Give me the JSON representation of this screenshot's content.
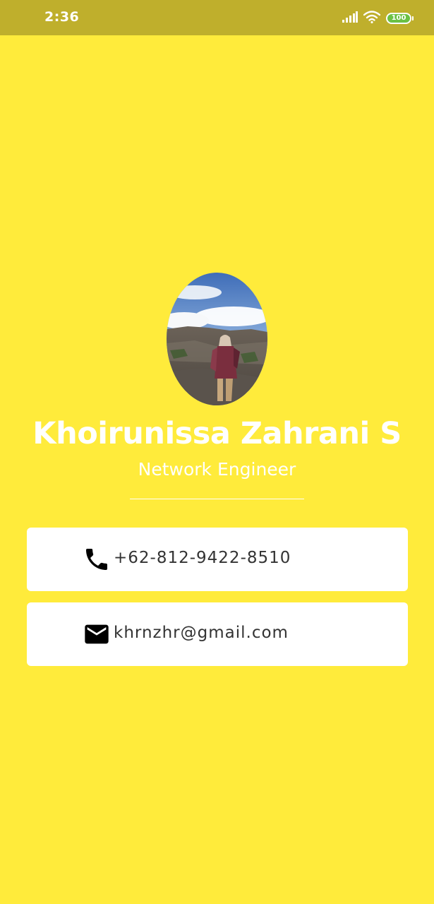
{
  "status_bar": {
    "time": "2:36",
    "battery": "100",
    "icons": [
      "signal-icon",
      "wifi-icon",
      "battery-icon"
    ],
    "background": "#BFAF2C"
  },
  "profile": {
    "name": "Khoirunissa Zahrani S",
    "title": "Network Engineer",
    "avatar_icon": "profile-photo"
  },
  "contacts": [
    {
      "icon": "phone-icon",
      "value": "+62-812-9422-8510"
    },
    {
      "icon": "email-icon",
      "value": "khrnzhr@gmail.com"
    }
  ],
  "colors": {
    "background": "#FFEB3B",
    "card": "#FFFFFF",
    "text_on_bg": "#FFFFFF",
    "card_text": "#333333"
  }
}
